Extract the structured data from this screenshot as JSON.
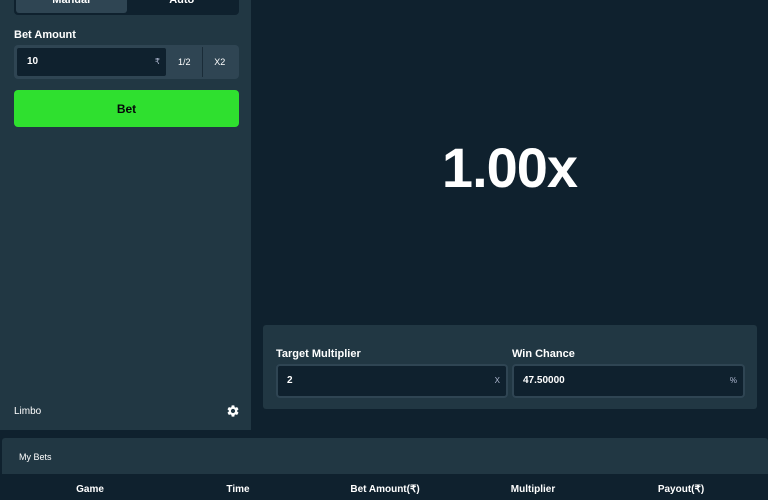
{
  "sidebar": {
    "tabs": [
      {
        "label": "Manual",
        "active": true
      },
      {
        "label": "Auto",
        "active": false
      }
    ],
    "bet_amount_label": "Bet Amount",
    "bet_amount_value": "10",
    "currency_symbol": "₹",
    "half_label": "1/2",
    "double_label": "X2",
    "bet_button_label": "Bet",
    "game_name": "Limbo"
  },
  "game": {
    "multiplier_display": "1.00x"
  },
  "controls": {
    "target_label": "Target Multiplier",
    "target_value": "2",
    "target_suffix": "X",
    "chance_label": "Win Chance",
    "chance_value": "47.50000",
    "chance_suffix": "%"
  },
  "bets": {
    "title": "My Bets",
    "columns": [
      "Game",
      "Time",
      "Bet Amount(₹)",
      "Multiplier",
      "Payout(₹)"
    ]
  },
  "colors": {
    "accent_green": "#2fe02f",
    "panel": "#213743",
    "background": "#0f212e"
  }
}
